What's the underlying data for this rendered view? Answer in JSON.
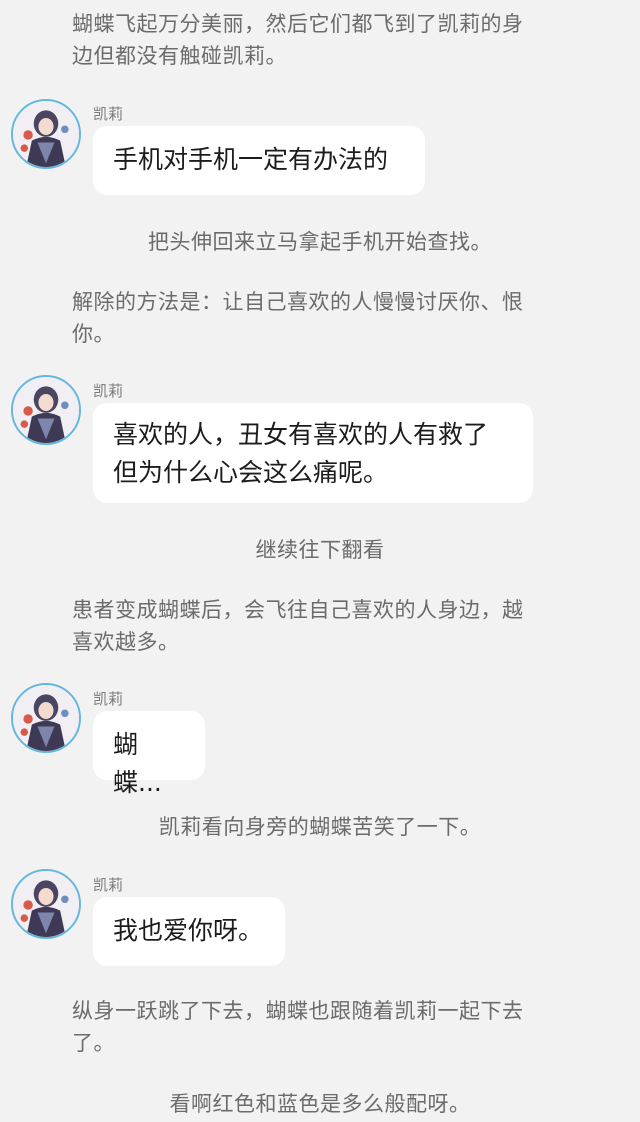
{
  "story": {
    "narration_1": "蝴蝶飞起万分美丽，然后它们都飞到了凯莉的身\n边但都没有触碰凯莉。",
    "message_1": {
      "speaker": "凯莉",
      "text": "手机对手机一定有办法的"
    },
    "narration_2": "把头伸回来立马拿起手机开始查找。",
    "narration_3": "解除的方法是：让自己喜欢的人慢慢讨厌你、恨\n你。",
    "message_2": {
      "speaker": "凯莉",
      "text": "喜欢的人，丑女有喜欢的人有救了\n但为什么心会这么痛呢。"
    },
    "narration_4": "继续往下翻看",
    "narration_5": "患者变成蝴蝶后，会飞往自己喜欢的人身边，越\n喜欢越多。",
    "message_3": {
      "speaker": "凯莉",
      "text": "蝴蝶..."
    },
    "narration_6": "凯莉看向身旁的蝴蝶苦笑了一下。",
    "message_4": {
      "speaker": "凯莉",
      "text": "我也爱你呀。"
    },
    "narration_7": "纵身一跃跳了下去，蝴蝶也跟随着凯莉一起下去\n了。",
    "narration_8": "看啊红色和蓝色是多么般配呀。"
  },
  "avatar_icon": "character-portrait-icon",
  "colors": {
    "background": "#f2f2f2",
    "bubble": "#ffffff",
    "avatar_ring": "#63b7df",
    "narration_text": "#6b6b6b",
    "bubble_text": "#1c1c1c"
  }
}
